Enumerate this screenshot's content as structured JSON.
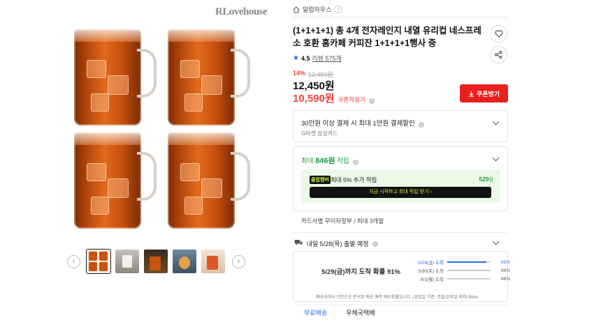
{
  "gallery": {
    "brand": "RLovehouse",
    "prev_icon": "‹",
    "next_icon": "›",
    "thumb_count": 5
  },
  "store": {
    "name": "알럽하우스",
    "chevron": "›"
  },
  "product": {
    "title": "(1+1+1+1) 총 4개 전자레인지 내열 유리컵 네스프레소 호환 홈카페 커피잔 1+1+1+1행사 중",
    "rating": "4.5",
    "reviews": "리뷰 575개",
    "discount_pct": "14%",
    "original_price": "12,450원",
    "price": "12,450원",
    "coupon_price": "10,590원",
    "coupon_price_label": "쿠폰적용가",
    "coupon_button": "쿠폰받기"
  },
  "card_benefit": {
    "title": "30만원 이상 결제 시 최대 1만원 결제할인",
    "sub": "G마켓 삼성카드"
  },
  "points": {
    "title_prefix": "최대 ",
    "amount": "846원",
    "title_suffix": " 적립",
    "club_badge": "클럽멤버",
    "club_text": "최대 5% 추가 적립",
    "club_amount": "529",
    "club_unit": "원",
    "club_cta": "지금 시작하고 최대 적립 받기 ›"
  },
  "installment": "카드사별 무이자할부 / 최대 3개월",
  "shipping": {
    "title": "내일 5/28(목) 출발 예정",
    "headline_bold": "5/29(금)까지 도착 확률 91%",
    "rows": [
      {
        "date": "5/29(금) 도착",
        "pct": "91%",
        "value": 0.91
      },
      {
        "date": "5/30(토) 도착",
        "pct": "98%",
        "value": 0.98
      },
      {
        "date": "6/1(월) 도착",
        "pct": "98%",
        "value": 0.98
      }
    ],
    "note": "배송데이터 기반으로 분석된 배송 예측 배송확률입니다. (영업일 기준, 주말/공휴일 제외) Beta"
  },
  "tabs": [
    "무료배송",
    "우체국택배"
  ],
  "colors": {
    "accent_red": "#e8201e",
    "sale_red": "#f0413b",
    "green": "#1e9c3c",
    "blue": "#2a6ae8"
  }
}
